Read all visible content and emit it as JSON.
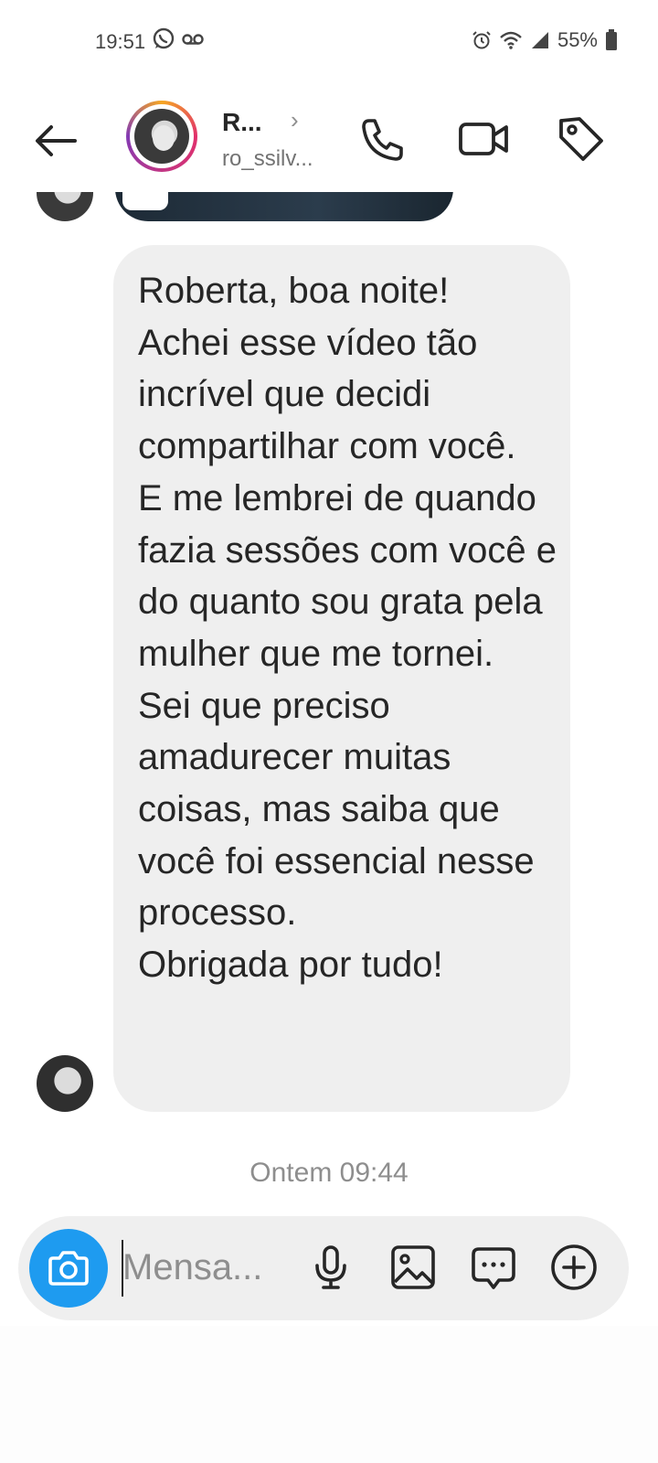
{
  "status_bar": {
    "time": "19:51",
    "battery": "55%",
    "icons": [
      "whatsapp-icon",
      "voicemail-icon",
      "alarm-icon",
      "wifi-icon",
      "signal-icon",
      "battery-icon"
    ]
  },
  "header": {
    "contact_name": "R...",
    "chevron": "›",
    "username": "ro_ssilv...",
    "icons": [
      "back-arrow-icon",
      "phone-icon",
      "video-camera-icon",
      "tag-icon"
    ]
  },
  "thread": {
    "message": "Roberta, boa noite!\nAchei esse vídeo tão incrível que decidi compartilhar com você.\nE me lembrei de quando fazia sessões com você e do quanto sou grata pela mulher que me tornei.\nSei que preciso amadurecer muitas coisas, mas saiba que você foi essencial nesse processo.\nObrigada por tudo!",
    "timestamp": "Ontem 09:44"
  },
  "composer": {
    "placeholder": "Mensa...",
    "icons": [
      "camera-icon",
      "microphone-icon",
      "gallery-icon",
      "sticker-icon",
      "plus-circle-icon"
    ]
  },
  "colors": {
    "accent": "#1e9bf0",
    "bubble": "#efefef",
    "text": "#262626",
    "muted": "#8e8e8e"
  }
}
